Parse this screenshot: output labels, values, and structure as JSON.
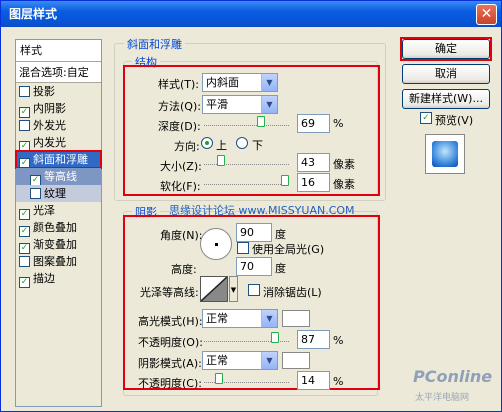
{
  "window": {
    "title": "图层样式"
  },
  "left_panel": {
    "header": "样式",
    "blend_options": "混合选项:自定",
    "items": [
      {
        "label": "投影",
        "checked": false
      },
      {
        "label": "内阴影",
        "checked": true
      },
      {
        "label": "外发光",
        "checked": false
      },
      {
        "label": "内发光",
        "checked": true
      },
      {
        "label": "斜面和浮雕",
        "checked": true,
        "selected": true
      },
      {
        "label": "等高线",
        "checked": true,
        "sub": true
      },
      {
        "label": "纹理",
        "checked": false,
        "sub": true
      },
      {
        "label": "光泽",
        "checked": true
      },
      {
        "label": "颜色叠加",
        "checked": true
      },
      {
        "label": "渐变叠加",
        "checked": true
      },
      {
        "label": "图案叠加",
        "checked": false
      },
      {
        "label": "描边",
        "checked": true
      }
    ]
  },
  "bevel": {
    "title": "斜面和浮雕",
    "structure": "结构",
    "style_label": "样式(T):",
    "style_value": "内斜面",
    "technique_label": "方法(Q):",
    "technique_value": "平滑",
    "depth_label": "深度(D):",
    "depth_value": "69",
    "depth_unit": "%",
    "depth_fraction": 0.69,
    "direction_label": "方向:",
    "dir_up": "上",
    "dir_down": "下",
    "size_label": "大小(Z):",
    "size_value": "43",
    "size_unit": "像素",
    "size_fraction": 0.17,
    "soften_label": "软化(F):",
    "soften_value": "16",
    "soften_unit": "像素",
    "soften_fraction": 1.0
  },
  "shading": {
    "title": "阴影",
    "watermark": "思缘设计论坛 www.MISSYUAN.COM",
    "angle_label": "角度(N):",
    "angle_value": "90",
    "angle_unit": "度",
    "global_light": "使用全局光(G)",
    "altitude_label": "高度:",
    "altitude_value": "70",
    "altitude_unit": "度",
    "gloss_label": "光泽等高线:",
    "antialias": "消除锯齿(L)",
    "highlight_label": "高光模式(H):",
    "highlight_mode": "正常",
    "hl_opacity_label": "不透明度(O):",
    "hl_opacity_value": "87",
    "hl_opacity_unit": "%",
    "hl_fraction": 0.87,
    "shadow_label": "阴影模式(A):",
    "shadow_mode": "正常",
    "sh_opacity_label": "不透明度(C):",
    "sh_opacity_value": "14",
    "sh_opacity_unit": "%",
    "sh_fraction": 0.14
  },
  "buttons": {
    "ok": "确定",
    "cancel": "取消",
    "new_style": "新建样式(W)...",
    "preview": "预览(V)"
  },
  "brand": {
    "logo": "PConline",
    "sub": "太平洋电脑网"
  }
}
